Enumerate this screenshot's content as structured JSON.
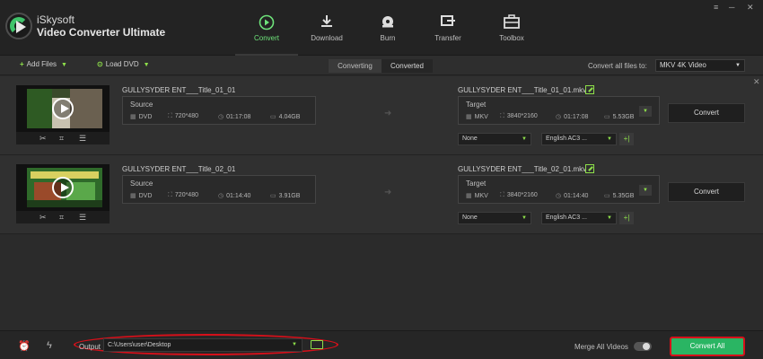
{
  "app": {
    "name_line1": "iSkysoft",
    "name_line2": "Video Converter Ultimate"
  },
  "nav": [
    {
      "label": "Convert",
      "icon": "convert-icon",
      "active": true
    },
    {
      "label": "Download",
      "icon": "download-icon"
    },
    {
      "label": "Burn",
      "icon": "burn-icon"
    },
    {
      "label": "Transfer",
      "icon": "transfer-icon"
    },
    {
      "label": "Toolbox",
      "icon": "toolbox-icon"
    }
  ],
  "window": {
    "menu": "≡",
    "minimize": "─",
    "close": "✕"
  },
  "toolbar": {
    "add_files": "Add Files",
    "load_dvd": "Load DVD",
    "tab_converting": "Converting",
    "tab_converted": "Converted",
    "convert_all_to_label": "Convert all files to:",
    "format": "MKV 4K Video"
  },
  "rows": [
    {
      "title": "GULLYSYDER ENT___Title_01_01",
      "source": {
        "label": "Source",
        "format": "DVD",
        "resolution": "720*480",
        "duration": "01:17:08",
        "size": "4.04GB"
      },
      "target_name": "GULLYSYDER ENT___Title_01_01.mkv",
      "target": {
        "label": "Target",
        "format": "MKV",
        "resolution": "3840*2160",
        "duration": "01:17:08",
        "size": "5.53GB"
      },
      "subtitle": "None",
      "audio": "English AC3 ...",
      "convert_label": "Convert"
    },
    {
      "title": "GULLYSYDER ENT___Title_02_01",
      "source": {
        "label": "Source",
        "format": "DVD",
        "resolution": "720*480",
        "duration": "01:14:40",
        "size": "3.91GB"
      },
      "target_name": "GULLYSYDER ENT___Title_02_01.mkv",
      "target": {
        "label": "Target",
        "format": "MKV",
        "resolution": "3840*2160",
        "duration": "01:14:40",
        "size": "5.35GB"
      },
      "subtitle": "None",
      "audio": "English AC3 ...",
      "convert_label": "Convert"
    }
  ],
  "bottom": {
    "output_label": "Output",
    "output_path": "C:\\Users\\user\\Desktop",
    "merge_label": "Merge All Videos",
    "convert_all_label": "Convert All"
  },
  "colors": {
    "accent_green": "#8ee04a",
    "convert_all_bg": "#2ab563",
    "highlight_red": "#d6101a"
  }
}
